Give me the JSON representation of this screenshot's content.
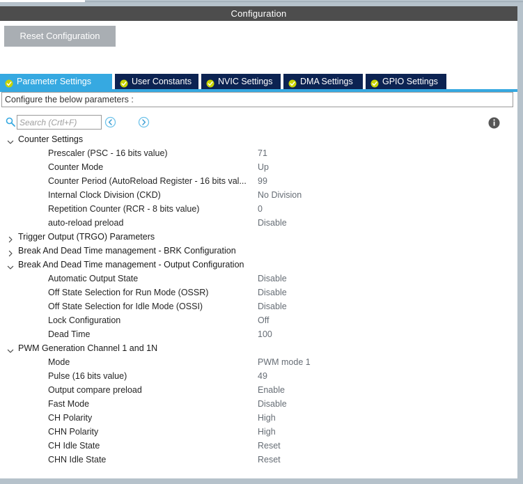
{
  "window": {
    "title": "Configuration"
  },
  "toolbar": {
    "reset_label": "Reset Configuration"
  },
  "tabs": [
    {
      "label": "Parameter Settings",
      "icon": "check-circle-icon",
      "active": true
    },
    {
      "label": "User Constants",
      "icon": "check-circle-icon",
      "active": false
    },
    {
      "label": "NVIC Settings",
      "icon": "check-circle-icon",
      "active": false
    },
    {
      "label": "DMA Settings",
      "icon": "check-circle-icon",
      "active": false
    },
    {
      "label": "GPIO Settings",
      "icon": "check-circle-icon",
      "active": false
    }
  ],
  "configure": {
    "text": "Configure the below parameters :"
  },
  "search": {
    "placeholder": "Search (Crtl+F)",
    "value": "",
    "icon": "search-icon",
    "prev_icon": "chevron-left-circle-icon",
    "next_icon": "chevron-right-circle-icon"
  },
  "info": {
    "icon": "info-icon"
  },
  "colors": {
    "accent": "#36a9e1",
    "tab_inactive": "#0c2352",
    "titlebar": "#4d4d4d",
    "button": "#a9aeb3",
    "check": "#c8d400",
    "frame": "#b6c2cb",
    "value_text": "#666d75"
  },
  "groups": [
    {
      "name": "Counter Settings",
      "expanded": true,
      "rows": [
        {
          "label": "Prescaler (PSC - 16 bits value)",
          "value": "71"
        },
        {
          "label": "Counter Mode",
          "value": "Up"
        },
        {
          "label": "Counter Period (AutoReload Register - 16 bits val...",
          "value": "99"
        },
        {
          "label": "Internal Clock Division (CKD)",
          "value": "No Division"
        },
        {
          "label": "Repetition Counter (RCR - 8 bits value)",
          "value": "0"
        },
        {
          "label": "auto-reload preload",
          "value": "Disable"
        }
      ]
    },
    {
      "name": "Trigger Output (TRGO) Parameters",
      "expanded": false,
      "rows": []
    },
    {
      "name": "Break And Dead Time management - BRK Configuration",
      "expanded": false,
      "rows": []
    },
    {
      "name": "Break And Dead Time management - Output Configuration",
      "expanded": true,
      "rows": [
        {
          "label": "Automatic Output State",
          "value": "Disable"
        },
        {
          "label": "Off State Selection for Run Mode (OSSR)",
          "value": "Disable"
        },
        {
          "label": "Off State Selection for Idle Mode (OSSI)",
          "value": "Disable"
        },
        {
          "label": "Lock Configuration",
          "value": "Off"
        },
        {
          "label": "Dead Time",
          "value": "100"
        }
      ]
    },
    {
      "name": "PWM Generation Channel 1 and 1N",
      "expanded": true,
      "rows": [
        {
          "label": "Mode",
          "value": "PWM mode 1"
        },
        {
          "label": "Pulse (16 bits value)",
          "value": "49"
        },
        {
          "label": "Output compare preload",
          "value": "Enable"
        },
        {
          "label": "Fast Mode",
          "value": "Disable"
        },
        {
          "label": "CH Polarity",
          "value": "High"
        },
        {
          "label": "CHN Polarity",
          "value": "High"
        },
        {
          "label": "CH Idle State",
          "value": "Reset"
        },
        {
          "label": "CHN Idle State",
          "value": "Reset"
        }
      ]
    }
  ]
}
